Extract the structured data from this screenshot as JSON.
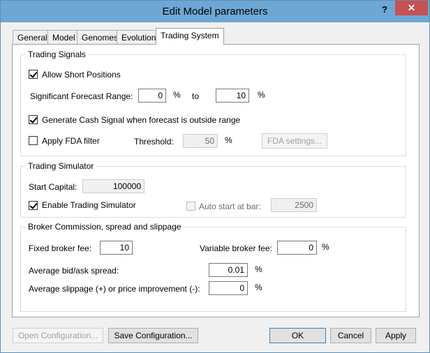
{
  "window": {
    "title": "Edit Model parameters",
    "help_label": "?",
    "close_label": "✕"
  },
  "tabs": [
    "General",
    "Model",
    "Genomes",
    "Evolution",
    "Trading System"
  ],
  "signals": {
    "group_title": "Trading Signals",
    "allow_short_label": "Allow Short Positions",
    "range_label": "Significant Forecast Range:",
    "range_from": "0",
    "range_from_unit": "%",
    "range_to_label": "to",
    "range_to": "10",
    "range_to_unit": "%",
    "cash_signal_label": "Generate Cash Signal when forecast is outside range",
    "fda_label": "Apply FDA filter",
    "threshold_label": "Threshold:",
    "threshold_value": "50",
    "threshold_unit": "%",
    "fda_settings_label": "FDA settings..."
  },
  "simulator": {
    "group_title": "Trading Simulator",
    "start_capital_label": "Start Capital:",
    "start_capital_value": "100000",
    "enable_label": "Enable Trading Simulator",
    "auto_start_label": "Auto start at bar:",
    "auto_start_value": "2500"
  },
  "broker": {
    "group_title": "Broker Commission, spread and slippage",
    "fixed_fee_label": "Fixed broker fee:",
    "fixed_fee_value": "10",
    "variable_fee_label": "Variable broker fee:",
    "variable_fee_value": "0",
    "variable_fee_unit": "%",
    "spread_label": "Average bid/ask spread:",
    "spread_value": "0.01",
    "spread_unit": "%",
    "slippage_label": "Average slippage (+) or price improvement (-):",
    "slippage_value": "0",
    "slippage_unit": "%"
  },
  "footer": {
    "open_config_label": "Open Configuration...",
    "save_config_label": "Save Configuration...",
    "ok_label": "OK",
    "cancel_label": "Cancel",
    "apply_label": "Apply"
  }
}
